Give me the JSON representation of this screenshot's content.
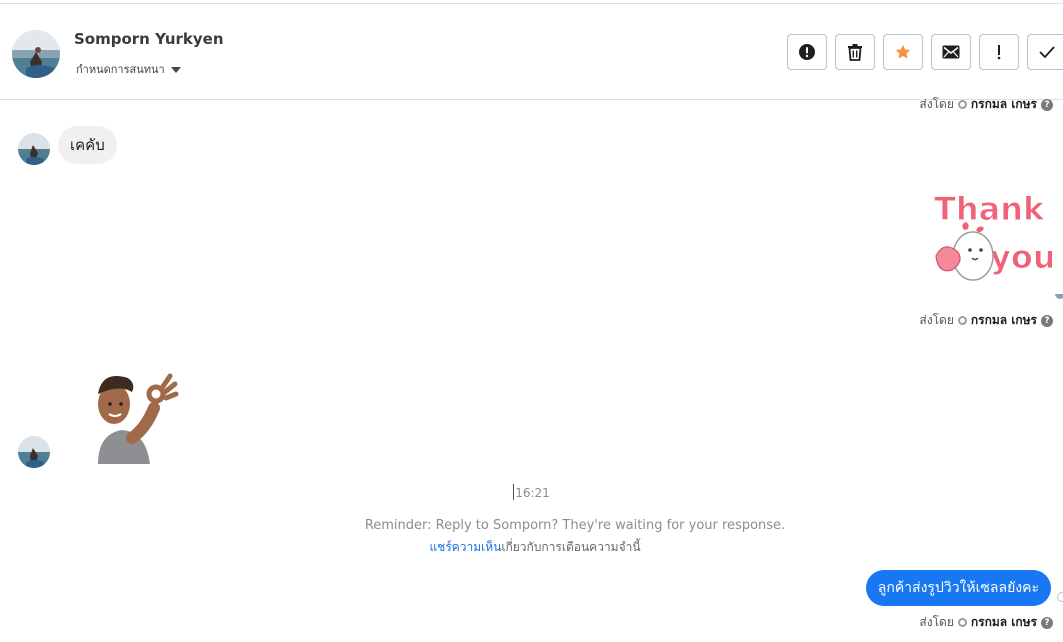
{
  "header": {
    "contact_name": "Somporn Yurkyen",
    "assign_label": "กำหนดการสนทนา",
    "actions": [
      {
        "name": "report-button",
        "icon": "alert-circle-icon"
      },
      {
        "name": "delete-button",
        "icon": "trash-icon"
      },
      {
        "name": "star-button",
        "icon": "star-icon"
      },
      {
        "name": "mark-unread-button",
        "icon": "envelope-icon"
      },
      {
        "name": "priority-button",
        "icon": "exclamation-icon"
      },
      {
        "name": "mark-done-button",
        "icon": "check-icon"
      }
    ]
  },
  "messages": {
    "sent_by_label": "ส่งโดย",
    "agent_name": "กรกมล เกษร",
    "help_glyph": "?",
    "incoming_text": "เคคับ",
    "sticker_thank_line1": "Thank",
    "sticker_thank_line2": "you",
    "timestamp": "16:21",
    "reminder": "Reminder: Reply to Somporn? They're waiting for your response.",
    "feedback_link": "แชร์ความเห็น",
    "feedback_rest": "เกี่ยวกับการเตือนความจำนี้",
    "outgoing_text": "ลูกค้าส่งรูปวิวให้เซลลยังคะ"
  },
  "colors": {
    "accent": "#1877f2",
    "star": "#f7923b",
    "sticker_pink": "#f06277",
    "link": "#216fdb"
  }
}
